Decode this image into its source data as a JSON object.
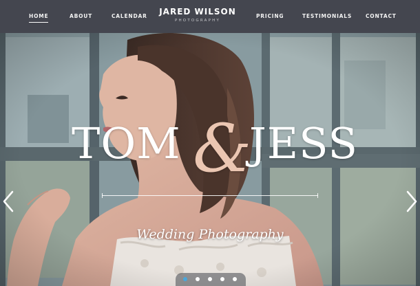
{
  "nav": {
    "items": [
      {
        "label": "HOME",
        "active": true
      },
      {
        "label": "ABOUT"
      },
      {
        "label": "CALENDAR"
      },
      {
        "label": "PRICING"
      },
      {
        "label": "TESTIMONIALS"
      },
      {
        "label": "CONTACT"
      }
    ]
  },
  "brand": {
    "name": "JARED WILSON",
    "tagline": "PHOTOGRAPHY"
  },
  "hero": {
    "name_left": "TOM",
    "ampersand": "&",
    "name_right": "JESS",
    "subtitle": "Wedding Photography",
    "prev_icon": "chevron-left-icon",
    "next_icon": "chevron-right-icon",
    "slide_count": 5,
    "active_slide": 1
  },
  "colors": {
    "header_bg": "#44464f",
    "ampersand": "#ebc6b2",
    "active_dot": "#49a7dc"
  }
}
